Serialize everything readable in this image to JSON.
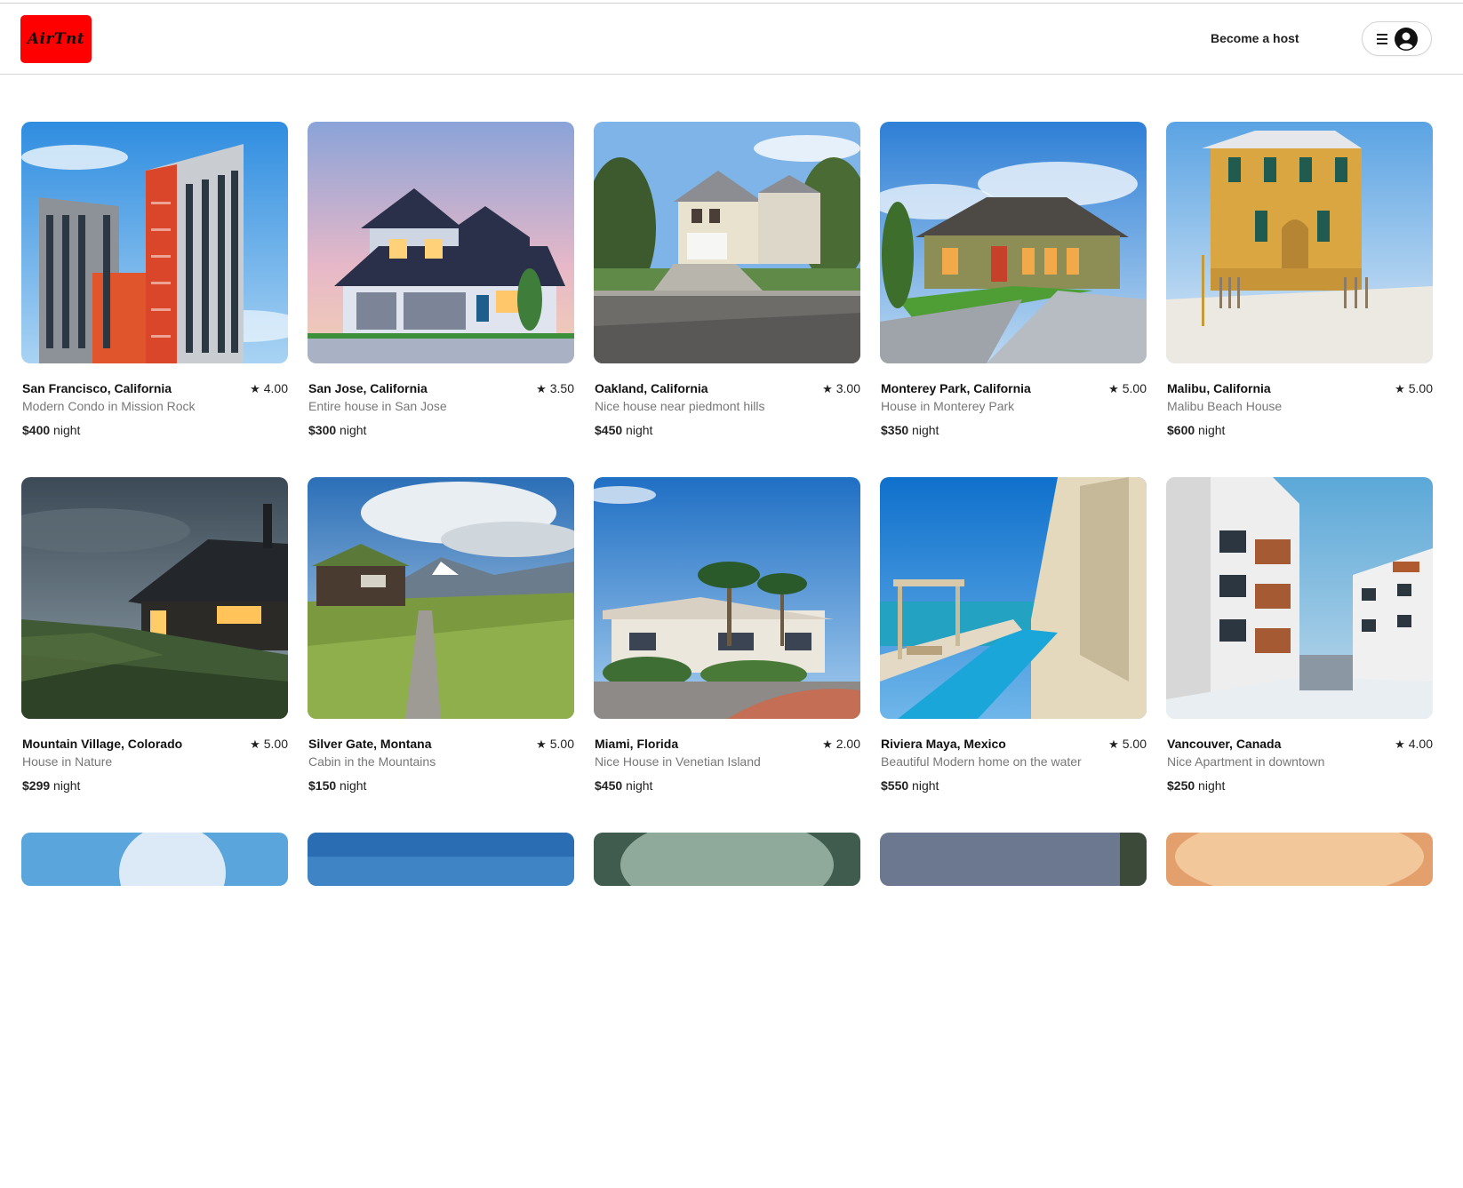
{
  "app": {
    "logo_text": "AirTnt",
    "brand_color": "#ff0000"
  },
  "header": {
    "become_host_label": "Become a host"
  },
  "listings": [
    {
      "location": "San Francisco, California",
      "rating": "4.00",
      "description": "Modern Condo in Mission Rock",
      "price": "$400",
      "unit": "night"
    },
    {
      "location": "San Jose, California",
      "rating": "3.50",
      "description": "Entire house in San Jose",
      "price": "$300",
      "unit": "night"
    },
    {
      "location": "Oakland, California",
      "rating": "3.00",
      "description": "Nice house near piedmont hills",
      "price": "$450",
      "unit": "night"
    },
    {
      "location": "Monterey Park, California",
      "rating": "5.00",
      "description": "House in Monterey Park",
      "price": "$350",
      "unit": "night"
    },
    {
      "location": "Malibu, California",
      "rating": "5.00",
      "description": "Malibu Beach House",
      "price": "$600",
      "unit": "night"
    },
    {
      "location": "Mountain Village, Colorado",
      "rating": "5.00",
      "description": "House in Nature",
      "price": "$299",
      "unit": "night"
    },
    {
      "location": "Silver Gate, Montana",
      "rating": "5.00",
      "description": "Cabin in the Mountains",
      "price": "$150",
      "unit": "night"
    },
    {
      "location": "Miami, Florida",
      "rating": "2.00",
      "description": "Nice House in Venetian Island",
      "price": "$450",
      "unit": "night"
    },
    {
      "location": "Riviera Maya, Mexico",
      "rating": "5.00",
      "description": "Beautiful Modern home on the water",
      "price": "$550",
      "unit": "night"
    },
    {
      "location": "Vancouver, Canada",
      "rating": "4.00",
      "description": "Nice Apartment in downtown",
      "price": "$250",
      "unit": "night"
    }
  ]
}
